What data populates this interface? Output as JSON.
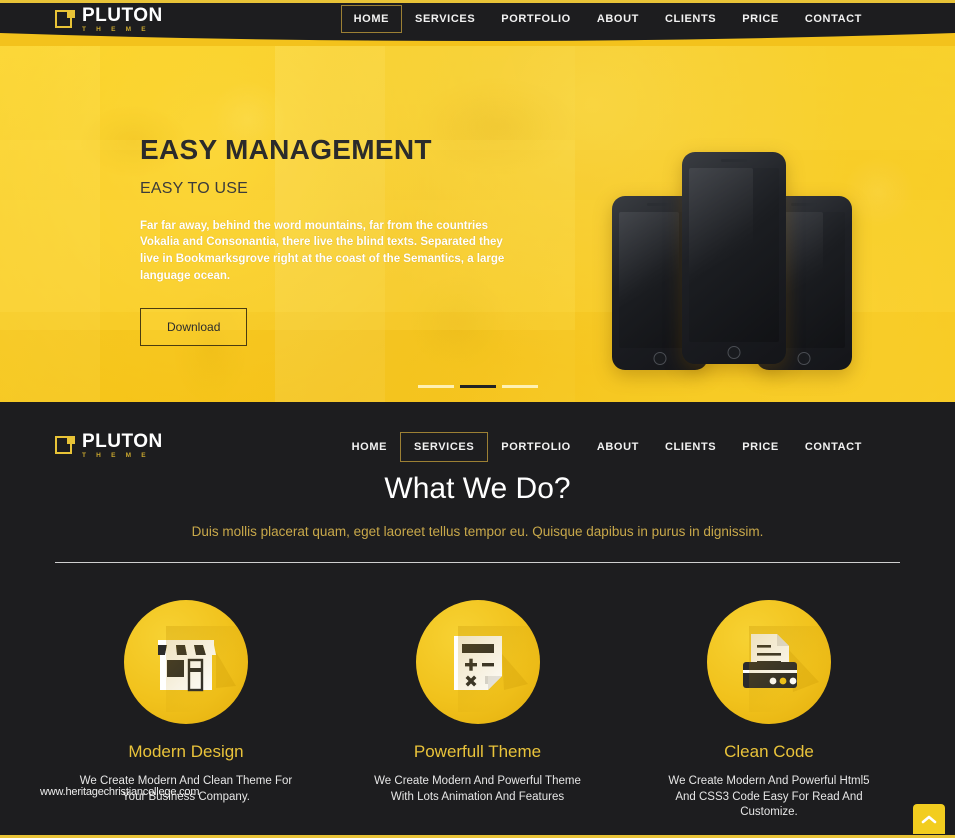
{
  "brand": {
    "name": "PLUTON",
    "tagline": "T H E M E",
    "accent": "#e8c337",
    "dark": "#1d1d1f"
  },
  "top_nav": {
    "items": [
      {
        "label": "HOME",
        "active": true
      },
      {
        "label": "SERVICES",
        "active": false
      },
      {
        "label": "PORTFOLIO",
        "active": false
      },
      {
        "label": "ABOUT",
        "active": false
      },
      {
        "label": "CLIENTS",
        "active": false
      },
      {
        "label": "PRICE",
        "active": false
      },
      {
        "label": "CONTACT",
        "active": false
      }
    ]
  },
  "hero": {
    "title": "EASY MANAGEMENT",
    "subtitle": "EASY TO USE",
    "paragraph": "Far far away, behind the word mountains, far from the countries Vokalia and Consonantia, there live the blind texts. Separated they live in Bookmarksgrove right at the coast of the Semantics, a large language ocean.",
    "button_label": "Download",
    "slider": {
      "total": 3,
      "active_index": 1
    }
  },
  "second_nav": {
    "items": [
      {
        "label": "HOME",
        "active": false
      },
      {
        "label": "SERVICES",
        "active": true
      },
      {
        "label": "PORTFOLIO",
        "active": false
      },
      {
        "label": "ABOUT",
        "active": false
      },
      {
        "label": "CLIENTS",
        "active": false
      },
      {
        "label": "PRICE",
        "active": false
      },
      {
        "label": "CONTACT",
        "active": false
      }
    ]
  },
  "services": {
    "heading": "What We Do?",
    "subheading": "Duis mollis placerat quam, eget laoreet tellus tempor eu. Quisque dapibus in purus in dignissim.",
    "cards": [
      {
        "icon": "storefront-icon",
        "title": "Modern Design",
        "description": "We Create Modern And Clean Theme For Your Business Company."
      },
      {
        "icon": "calculator-icon",
        "title": "Powerfull Theme",
        "description": "We Create Modern And Powerful Theme With Lots Animation And Features"
      },
      {
        "icon": "printer-document-icon",
        "title": "Clean Code",
        "description": "We Create Modern And Powerful Html5 And CSS3 Code Easy For Read And Customize."
      }
    ]
  },
  "watermark": {
    "text": "www.heritagechristiancollege.com"
  },
  "scroll_top": {
    "icon": "chevron-up-icon"
  }
}
